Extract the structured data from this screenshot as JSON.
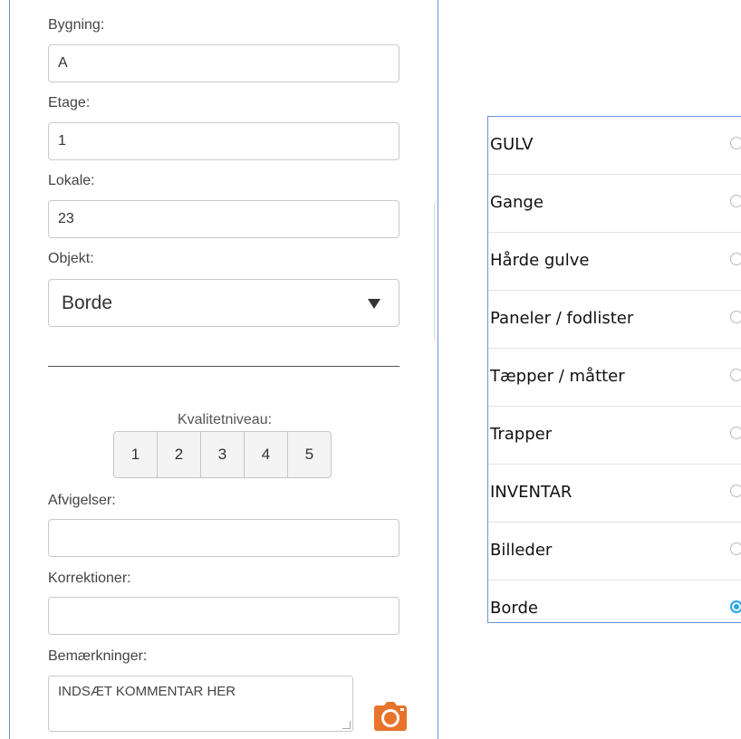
{
  "form": {
    "building": {
      "label": "Bygning:",
      "value": "A"
    },
    "floor": {
      "label": "Etage:",
      "value": "1"
    },
    "room": {
      "label": "Lokale:",
      "value": "23"
    },
    "object": {
      "label": "Objekt:",
      "value": "Borde"
    },
    "quality": {
      "label": "Kvalitetniveau:",
      "options": [
        "1",
        "2",
        "3",
        "4",
        "5"
      ]
    },
    "deviations": {
      "label": "Afvigelser:",
      "value": ""
    },
    "corrections": {
      "label": "Korrektioner:",
      "value": ""
    },
    "remarks": {
      "label": "Bemærkninger:",
      "value": "INDSÆT KOMMENTAR HER"
    },
    "camera_icon": "camera-icon",
    "accent_color": "#e8732a"
  },
  "list": {
    "items": [
      {
        "label": "GULV",
        "selected": false
      },
      {
        "label": "Gange",
        "selected": false
      },
      {
        "label": "Hårde gulve",
        "selected": false
      },
      {
        "label": "Paneler / fodlister",
        "selected": false
      },
      {
        "label": "Tæpper / måtter",
        "selected": false
      },
      {
        "label": "Trapper",
        "selected": false
      },
      {
        "label": "INVENTAR",
        "selected": false
      },
      {
        "label": "Billeder",
        "selected": false
      },
      {
        "label": "Borde",
        "selected": true
      }
    ],
    "selected_color": "#2aa4e6"
  }
}
